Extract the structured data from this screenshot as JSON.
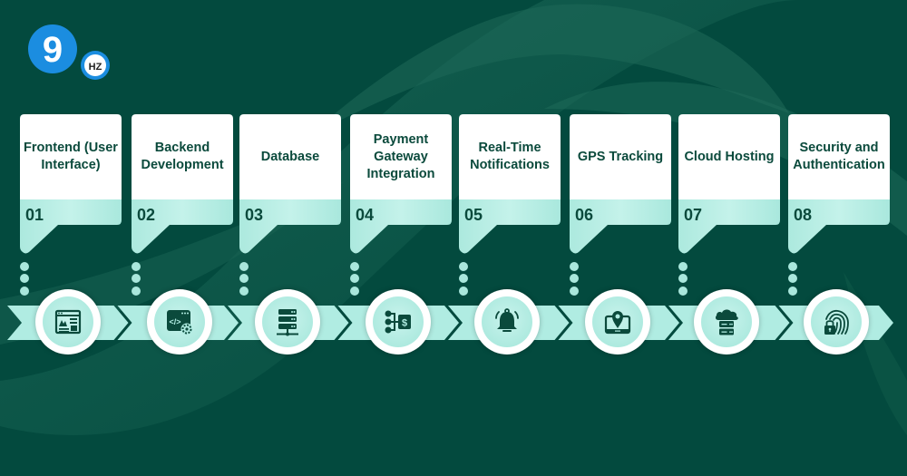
{
  "brand": {
    "logo_main": "9",
    "logo_badge": "HZ",
    "colors": {
      "background": "#034a3e",
      "swirl": "#1f6a5a",
      "mint": "#b0ece2",
      "text": "#0b4a3c",
      "logo_blue": "#1b8de0"
    }
  },
  "steps": [
    {
      "number": "01",
      "title": "Frontend (User Interface)",
      "icon": "web-layout-icon"
    },
    {
      "number": "02",
      "title": "Backend Development",
      "icon": "code-settings-icon"
    },
    {
      "number": "03",
      "title": "Database",
      "icon": "server-database-icon"
    },
    {
      "number": "04",
      "title": "Payment Gateway Integration",
      "icon": "payment-gateway-icon"
    },
    {
      "number": "05",
      "title": "Real-Time Notifications",
      "icon": "bell-icon"
    },
    {
      "number": "06",
      "title": "GPS Tracking",
      "icon": "laptop-location-icon"
    },
    {
      "number": "07",
      "title": "Cloud Hosting",
      "icon": "cloud-server-icon"
    },
    {
      "number": "08",
      "title": "Security and Authentication",
      "icon": "fingerprint-lock-icon"
    }
  ]
}
